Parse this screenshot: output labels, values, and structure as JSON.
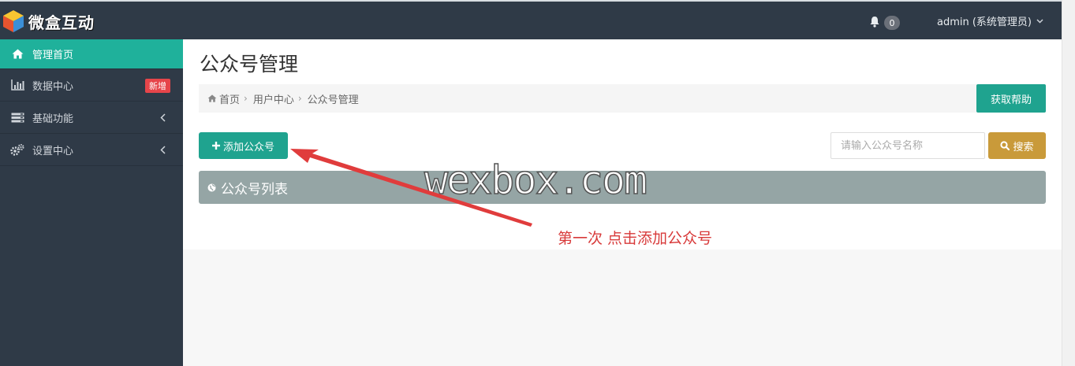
{
  "header": {
    "logo_text": "微盒互动",
    "notification_count": "0",
    "user_label": "admin (系统管理员)"
  },
  "sidebar": {
    "items": [
      {
        "label": "管理首页",
        "icon": "home-icon"
      },
      {
        "label": "数据中心",
        "icon": "bar-chart-icon",
        "badge": "新增"
      },
      {
        "label": "基础功能",
        "icon": "server-icon"
      },
      {
        "label": "设置中心",
        "icon": "gears-icon"
      }
    ]
  },
  "main": {
    "title": "公众号管理",
    "breadcrumb": [
      "首页",
      "用户中心",
      "公众号管理"
    ],
    "help_button": "获取帮助",
    "add_button": "添加公众号",
    "search_placeholder": "请输入公众号名称",
    "search_button": "搜索",
    "panel_title": "公众号列表"
  },
  "overlay": {
    "watermark": "wexbox.com",
    "annotation": "第一次 点击添加公众号"
  },
  "colors": {
    "topbar": "#2f3a47",
    "accent": "#1fa38f",
    "active_nav": "#1fb19b",
    "search_button": "#c99a3a",
    "panel_header": "#95a5a5",
    "badge": "#e6454a",
    "annotation": "#d83a3a"
  }
}
